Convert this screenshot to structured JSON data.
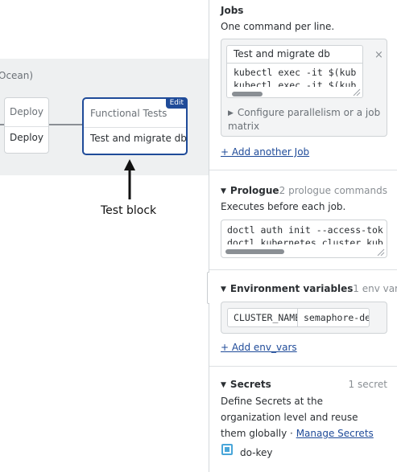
{
  "canvas": {
    "lane_title": "Ocean)",
    "deploy_block": {
      "name": "Deploy",
      "job": "Deploy"
    },
    "test_block": {
      "name": "Functional Tests",
      "job": "Test and migrate db",
      "edit_label": "Edit"
    },
    "callout": "Test block"
  },
  "jobs": {
    "header": "Jobs",
    "description": "One command per line.",
    "job_name": "Test and migrate db",
    "commands": [
      "kubectl exec -it $(kub",
      "kubectl exec -it $(kub"
    ],
    "config_link": "Configure parallelism or a job matrix",
    "add_job_link": "+ Add another Job",
    "remove_symbol": "×"
  },
  "prologue": {
    "header": "Prologue",
    "meta": "2 prologue commands",
    "description": "Executes before each job.",
    "commands": [
      "doctl auth init --access-tok",
      "doctl kubernetes cluster kub"
    ]
  },
  "env_vars": {
    "header": "Environment variables",
    "meta": "1 env var",
    "name_value": "CLUSTER_NAME",
    "value_value": "semaphore-demo",
    "add_link": "+ Add env_vars"
  },
  "secrets": {
    "header": "Secrets",
    "meta": "1 secret",
    "description": "Define Secrets at the organization level and reuse them globally · ",
    "manage_link": "Manage Secrets",
    "items": [
      {
        "label": "do-key",
        "checked": true
      }
    ]
  },
  "colors": {
    "accent": "#1f4b99",
    "checkbox": "#49a6d9",
    "lane_bg": "#eef0f1"
  }
}
